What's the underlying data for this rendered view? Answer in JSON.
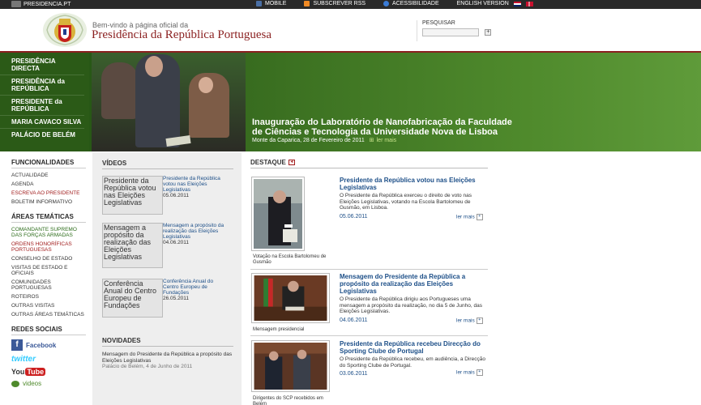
{
  "topbar": {
    "site": "PRESIDENCIA.PT",
    "links": [
      "MOBILE",
      "SUBSCREVER RSS",
      "ACESSIBILIDADE",
      "ENGLISH VERSION"
    ]
  },
  "header": {
    "welcome": "Bem-vindo à página oficial da",
    "title": "Presidência da República Portuguesa",
    "search_label": "PESQUISAR",
    "search_button": "+"
  },
  "banner": {
    "nav": [
      "PRESIDÊNCIA DIRECTA",
      "PRESIDÊNCIA da REPÚBLICA",
      "PRESIDENTE da REPÚBLICA",
      "MARIA CAVACO SILVA",
      "PALÁCIO DE BELÉM"
    ],
    "headline": "Inauguração do Laboratório de Nanofabricação da Faculdade de Ciências e Tecnologia da Universidade Nova de Lisboa",
    "place_date": "Monte da Caparica, 28 de Fevereiro de 2011",
    "more": "ler mais"
  },
  "sidebar": {
    "func_title": "FUNCIONALIDADES",
    "func_items": [
      "ACTUALIDADE",
      "AGENDA",
      "ESCREVA AO PRESIDENTE",
      "BOLETIM INFORMATIVO"
    ],
    "areas_title": "ÁREAS TEMÁTICAS",
    "areas_items": [
      "COMANDANTE SUPREMO DAS FORÇAS ARMADAS",
      "ORDENS HONORÍFICAS PORTUGUESAS",
      "CONSELHO DE ESTADO",
      "VISITAS DE ESTADO E OFICIAIS",
      "COMUNIDADES PORTUGUESAS",
      "ROTEIROS",
      "OUTRAS VISITAS",
      "OUTRAS ÁREAS TEMÁTICAS"
    ],
    "social_title": "REDES SOCIAIS",
    "facebook": "Facebook",
    "twitter": "twitter",
    "youtube_you": "You",
    "youtube_tube": "Tube",
    "videos": "videos"
  },
  "videos": {
    "title": "VÍDEOS",
    "items": [
      {
        "thumb": "Presidente da República votou nas Eleições Legislativas",
        "caption": "Presidente da República votou nas Eleições Legislativas",
        "date": "05.06.2011"
      },
      {
        "thumb": "Mensagem a propósito da realização das Eleições Legislativas",
        "caption": "Mensagem a propósito da realização das Eleições Legislativas",
        "date": "04.06.2011"
      },
      {
        "thumb": "Conferência Anual do Centro Europeu de Fundações",
        "caption": "Conferência Anual do Centro Europeu de Fundações",
        "date": "26.05.2011"
      }
    ]
  },
  "novidades": {
    "title": "NOVIDADES",
    "text": "Mensagem do Presidente da República a propósito das Eleições Legislativas",
    "meta": "Palácio de Belém, 4 de Junho de 2011"
  },
  "destaque": {
    "title": "DESTAQUE",
    "items": [
      {
        "title": "Presidente da República votou nas Eleições Legislativas",
        "body": "O Presidente da República exerceu o direito de voto nas Eleições Legislativas, votando na Escola Bartolomeu de Gusmão, em Lisboa.",
        "date": "05.06.2011",
        "more": "ler mais",
        "img_caption": "Votação na Escola Bartolomeu de Gusmão"
      },
      {
        "title": "Mensagem do Presidente da República a propósito da realização das Eleições Legislativas",
        "body": "O Presidente da República dirigiu aos Portugueses uma mensagem a propósito da realização, no dia 5 de Junho, das Eleições Legislativas.",
        "date": "04.06.2011",
        "more": "ler mais",
        "img_caption": "Mensagem presidencial"
      },
      {
        "title": "Presidente da República recebeu Direcção do Sporting Clube de Portugal",
        "body": "O Presidente da República recebeu, em audiência, a Direcção do Sporting Clube de Portugal.",
        "date": "03.06.2011",
        "more": "ler mais",
        "img_caption": "Dirigentes do SCP recebidos em Belém"
      }
    ]
  },
  "colors": {
    "brand_red": "#8a1f1f",
    "green": "#2b5a17",
    "link": "#1d4f88"
  }
}
